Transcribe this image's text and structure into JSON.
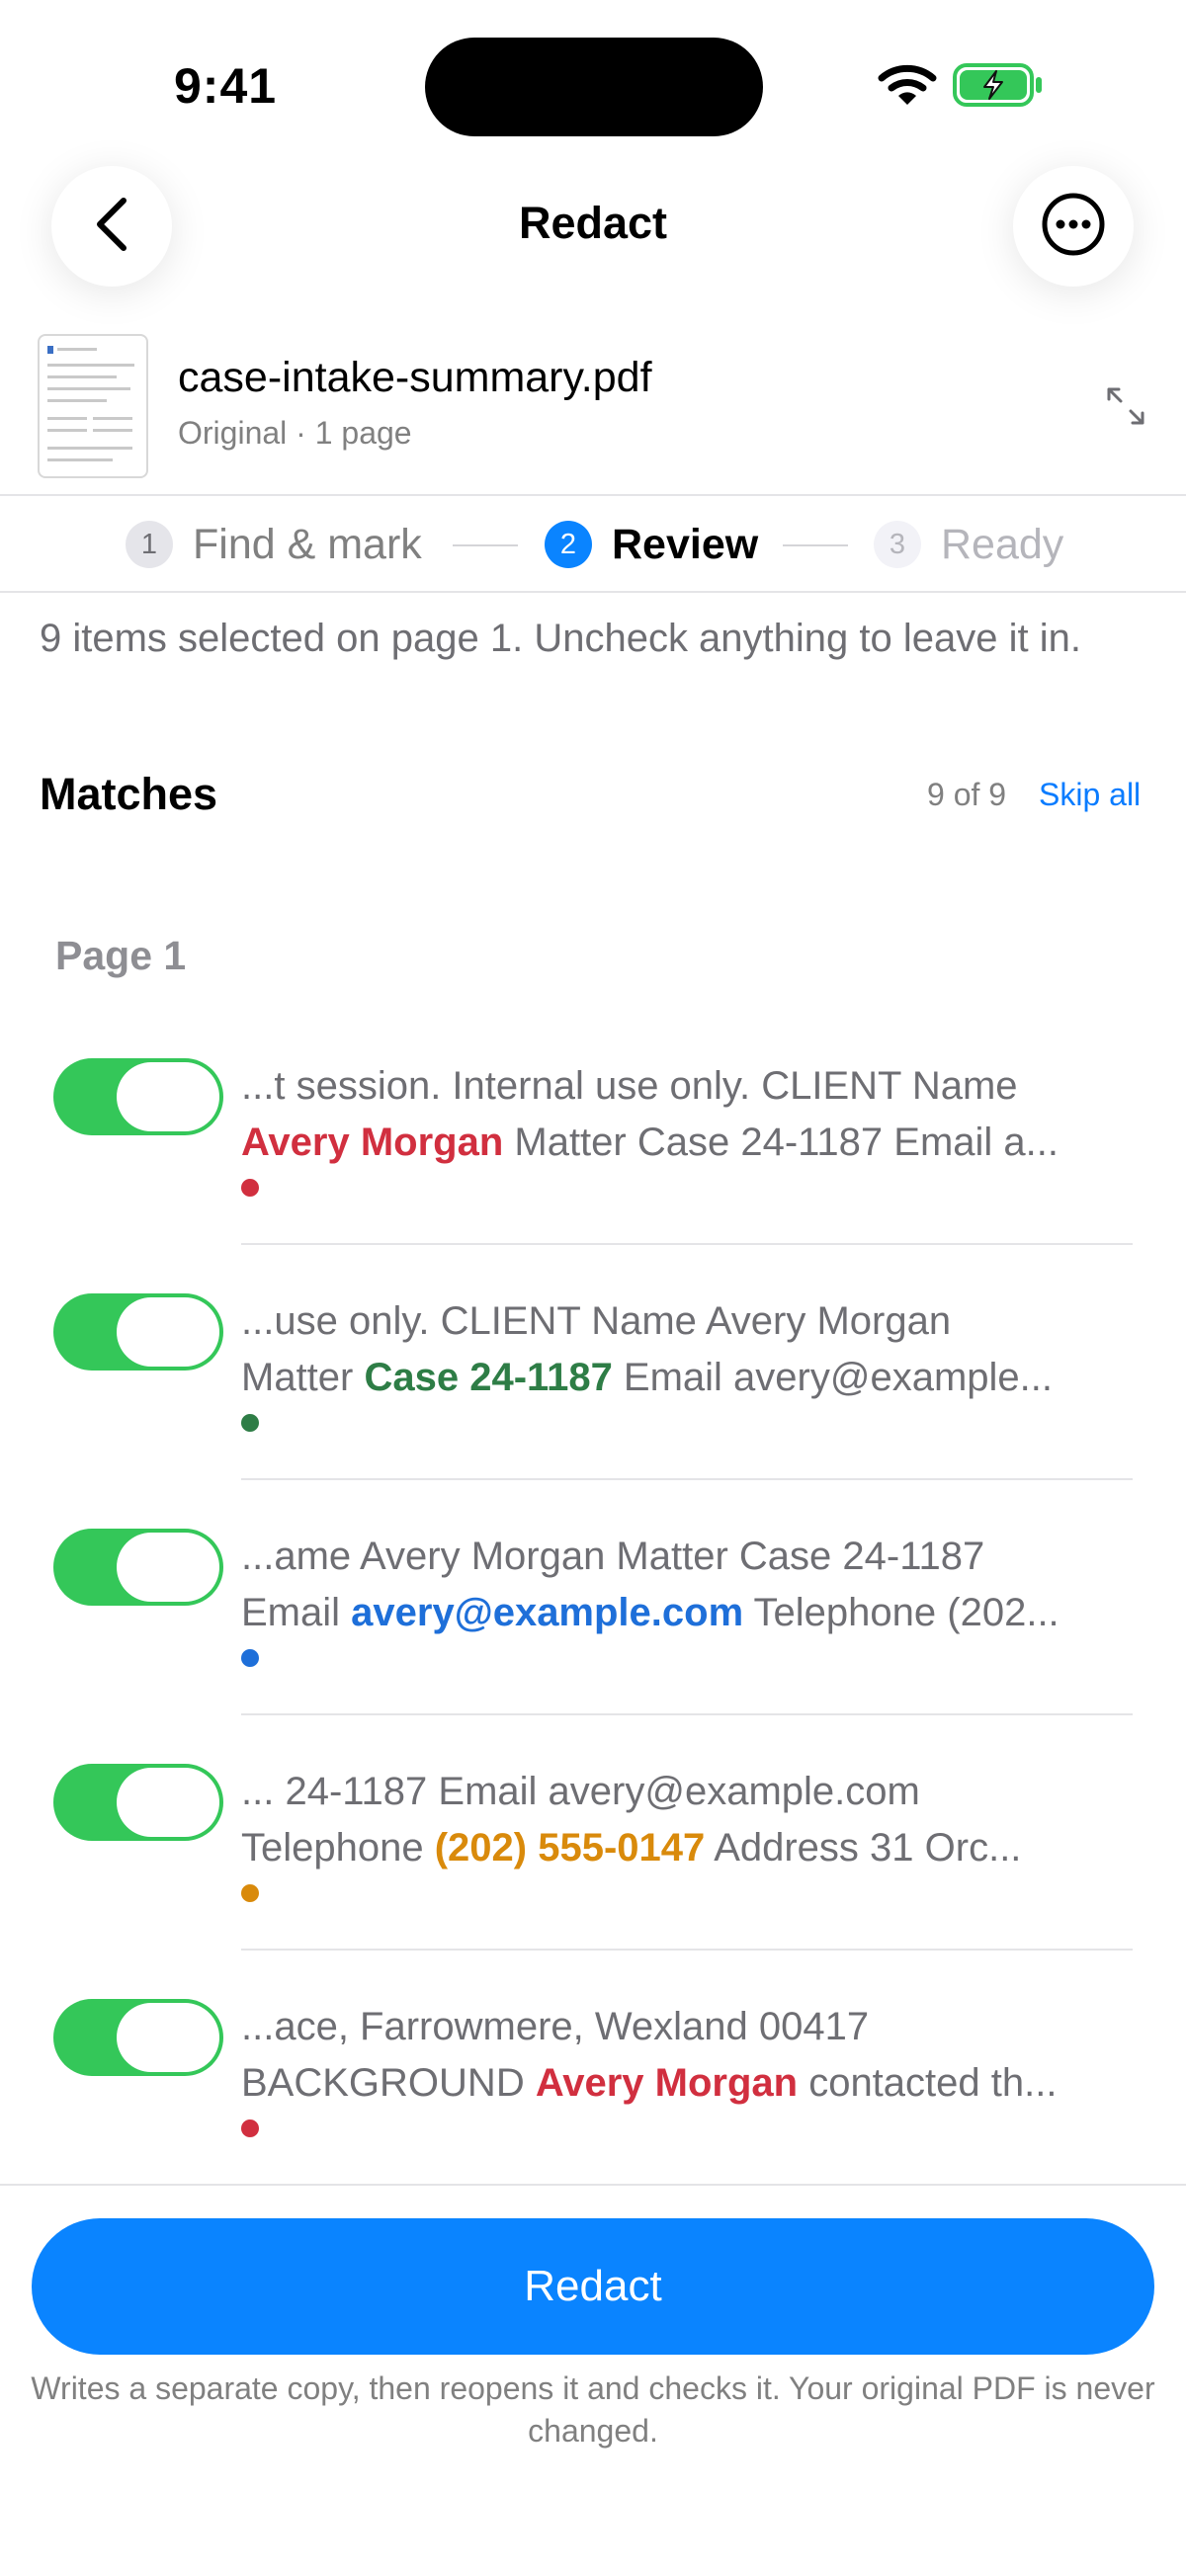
{
  "status_bar": {
    "time": "9:41"
  },
  "nav": {
    "title": "Redact",
    "back_icon": "chevron-left-icon",
    "more_icon": "ellipsis-circle-icon"
  },
  "document": {
    "name": "case-intake-summary.pdf",
    "subtitle": "Original · 1 page"
  },
  "stepper": {
    "steps": [
      {
        "num": "1",
        "label": "Find & mark",
        "state": "done"
      },
      {
        "num": "2",
        "label": "Review",
        "state": "active"
      },
      {
        "num": "3",
        "label": "Ready",
        "state": "upcoming"
      }
    ]
  },
  "intro_text": "9 items selected on page 1. Uncheck anything to leave it in.",
  "matches": {
    "heading": "Matches",
    "count": "9 of 9",
    "skip_label": "Skip all"
  },
  "page_heading": "Page 1",
  "items": [
    {
      "line1": "...t session. Internal use only. CLIENT Name",
      "before": "",
      "highlight": "Avery Morgan",
      "after": " Matter Case 24-1187 Email a...",
      "color": "#d12f3f",
      "checked": true
    },
    {
      "line1": "...use only. CLIENT Name Avery Morgan",
      "before": "Matter ",
      "highlight": "Case 24-1187",
      "after": " Email avery@example...",
      "color": "#2e7d46",
      "checked": true
    },
    {
      "line1": "...ame Avery Morgan Matter Case 24-1187",
      "before": "Email ",
      "highlight": "avery@example.com",
      "after": " Telephone (202...",
      "color": "#1e6fd9",
      "checked": true
    },
    {
      "line1": "... 24-1187 Email avery@example.com",
      "before": "Telephone ",
      "highlight": "(202) 555-0147",
      "after": " Address 31 Orc...",
      "color": "#d98a0b",
      "checked": true
    },
    {
      "line1": "...ace, Farrowmere, Wexland 00417",
      "before": "BACKGROUND ",
      "highlight": "Avery Morgan",
      "after": " contacted th...",
      "color": "#d12f3f",
      "checked": true
    }
  ],
  "actions": {
    "redact_label": "Redact"
  },
  "footnote": "Writes a separate copy, then reopens it and checks it. Your original PDF is never changed.",
  "colors": {
    "accent": "#0a84ff",
    "toggle_on": "#34c759"
  }
}
